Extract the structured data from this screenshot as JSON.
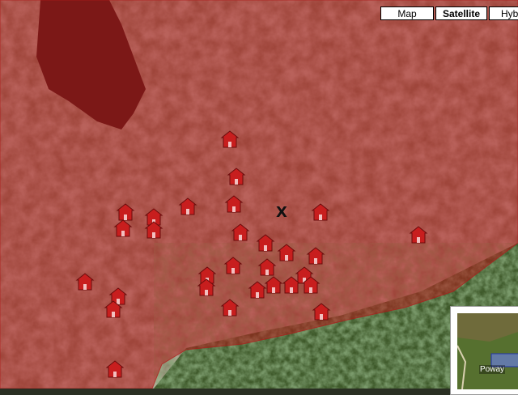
{
  "map_type_controls": {
    "map_label": "Map",
    "satellite_label": "Satellite",
    "hybrid_label": "Hyb",
    "active": "Satellite"
  },
  "overview_map": {
    "place_label": "Poway"
  },
  "location_marker": {
    "glyph": "X"
  },
  "fire_overlay": {
    "color": "#b01818"
  },
  "markers": {
    "icon": "house-icon",
    "color": "#c81e1e"
  }
}
